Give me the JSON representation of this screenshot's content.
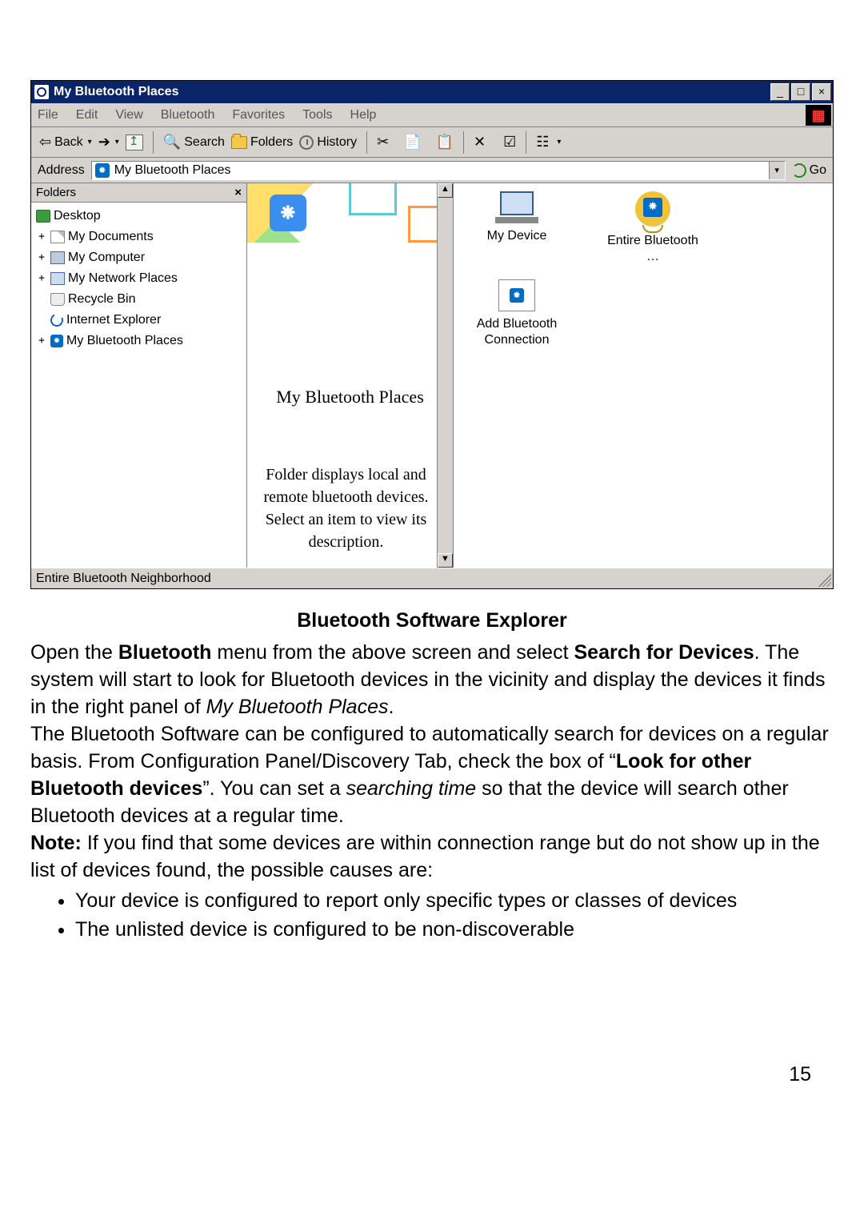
{
  "titlebar": {
    "text": "My Bluetooth Places"
  },
  "winbuttons": {
    "min": "_",
    "max": "□",
    "close": "×"
  },
  "menu": {
    "file": "File",
    "edit": "Edit",
    "view": "View",
    "bluetooth": "Bluetooth",
    "favorites": "Favorites",
    "tools": "Tools",
    "help": "Help"
  },
  "toolbar": {
    "back": "Back",
    "search": "Search",
    "folders": "Folders",
    "history": "History"
  },
  "address": {
    "label": "Address",
    "value": "My Bluetooth Places",
    "go": "Go"
  },
  "folders_pane": {
    "title": "Folders",
    "items": [
      {
        "label": "Desktop",
        "icon": "desktop",
        "expand": ""
      },
      {
        "label": "My Documents",
        "icon": "docs",
        "expand": "+"
      },
      {
        "label": "My Computer",
        "icon": "pc",
        "expand": "+"
      },
      {
        "label": "My Network Places",
        "icon": "net",
        "expand": "+"
      },
      {
        "label": "Recycle Bin",
        "icon": "bin",
        "expand": ""
      },
      {
        "label": "Internet Explorer",
        "icon": "ie",
        "expand": ""
      },
      {
        "label": "My Bluetooth Places",
        "icon": "bt",
        "expand": "+"
      }
    ]
  },
  "left_info": {
    "title": "My Bluetooth Places",
    "desc": "Folder displays local and remote bluetooth devices. Select an item to view its description."
  },
  "content": {
    "items": [
      {
        "label": "My Device"
      },
      {
        "label": "Entire Bluetooth …"
      },
      {
        "label": "Add Bluetooth Connection"
      }
    ]
  },
  "statusbar": "Entire Bluetooth Neighborhood",
  "doc": {
    "heading": "Bluetooth Software Explorer",
    "p1a": "Open the ",
    "p1b": "Bluetooth",
    "p1c": " menu from the above screen and select ",
    "p1d": "Search for Devices",
    "p1e": ". The system will start to look for Bluetooth devices in the vicinity and display the devices it finds in the right panel of ",
    "p1f": "My Bluetooth Places",
    "p1g": ".",
    "p2a": "The Bluetooth Software can be configured to automatically search for devices on a regular basis. From Configuration Panel/Discovery Tab, check the box of “",
    "p2b": "Look for other Bluetooth devices",
    "p2c": "”. You can set a ",
    "p2d": "searching time",
    "p2e": " so that the device will search other Bluetooth devices at a regular time.",
    "p3a": "Note:",
    "p3b": " If you find that  some devices are within connection range but do not show up in the list of devices found, the possible causes are:",
    "b1": "Your device is configured to report only specific types or classes of devices",
    "b2": "The unlisted device is configured to be non-discoverable"
  },
  "pagenum": "15"
}
